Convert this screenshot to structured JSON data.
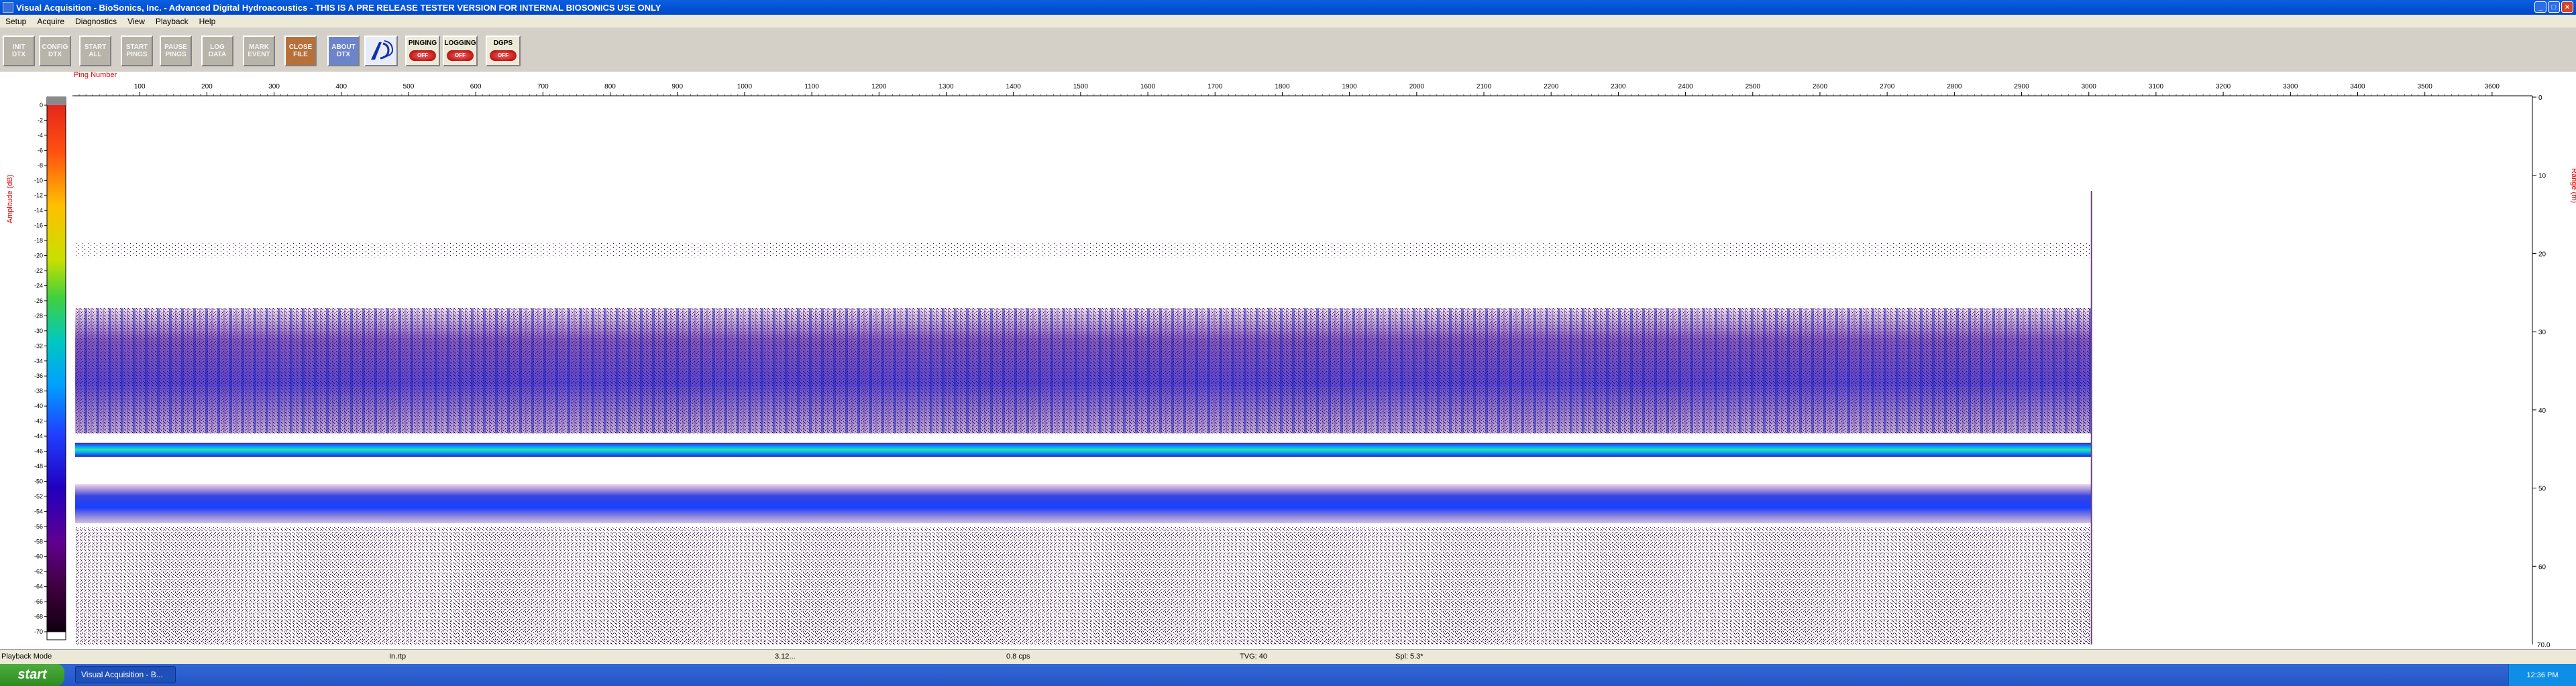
{
  "window": {
    "title": "Visual Acquisition  -  BioSonics, Inc.  -  Advanced Digital Hydroacoustics  -  THIS IS A PRE RELEASE TESTER VERSION FOR INTERNAL BIOSONICS USE ONLY"
  },
  "menu": [
    "Setup",
    "Acquire",
    "Diagnostics",
    "View",
    "Playback",
    "Help"
  ],
  "toolbar": {
    "buttons": [
      {
        "l1": "INIT",
        "l2": "DTX",
        "x": 4
      },
      {
        "l1": "CONFIG",
        "l2": "DTX",
        "x": 58
      },
      {
        "l1": "START",
        "l2": "ALL",
        "x": 118
      },
      {
        "l1": "START",
        "l2": "PINGS",
        "x": 180
      },
      {
        "l1": "PAUSE",
        "l2": "PINGS",
        "x": 238
      },
      {
        "l1": "LOG",
        "l2": "DATA",
        "x": 300
      },
      {
        "l1": "MARK",
        "l2": "EVENT",
        "x": 362
      },
      {
        "l1": "CLOSE",
        "l2": "FILE",
        "x": 424
      },
      {
        "l1": "ABOUT",
        "l2": "DTX",
        "x": 488
      }
    ],
    "indicators": [
      {
        "label": "PINGING",
        "state": "OFF",
        "x": 604
      },
      {
        "label": "LOGGING",
        "state": "OFF",
        "x": 660
      },
      {
        "label": "DGPS",
        "state": "OFF",
        "x": 724
      }
    ]
  },
  "chart_data": {
    "type": "heatmap",
    "xlabel": "Ping Number",
    "ylabel_left": "Amplitude (dB)",
    "ylabel_right": "Range (m)",
    "x_ticks": [
      100,
      200,
      300,
      400,
      500,
      600,
      700,
      800,
      900,
      1000,
      1100,
      1200,
      1300,
      1400,
      1500,
      1600,
      1700,
      1800,
      1900,
      2000,
      2100,
      2200,
      2300,
      2400,
      2500,
      2600,
      2700,
      2800,
      2900,
      3000,
      3100,
      3200,
      3300,
      3400,
      3500,
      3600
    ],
    "xlim": [
      0,
      3660
    ],
    "data_end_ping": 3000,
    "range_ticks": [
      0,
      10,
      20,
      30,
      40,
      50,
      60
    ],
    "range_end_label": "70.0",
    "ylim_range": [
      0,
      70
    ],
    "color_scale_ticks": [
      0,
      -2,
      -4,
      -6,
      -8,
      -10,
      -12,
      -14,
      -16,
      -18,
      -20,
      -22,
      -24,
      -26,
      -28,
      -30,
      -32,
      -34,
      -36,
      -38,
      -40,
      -42,
      -44,
      -46,
      -48,
      -50,
      -52,
      -54,
      -56,
      -58,
      -60,
      -62,
      -64,
      -66,
      -68,
      -70
    ],
    "bands": [
      {
        "range_m": [
          18.5,
          20.5
        ],
        "level": "weak"
      },
      {
        "range_m": [
          27,
          43
        ],
        "level": "moderate"
      },
      {
        "range_m": [
          44.2,
          46.0
        ],
        "level": "strong"
      },
      {
        "range_m": [
          49.5,
          54.5
        ],
        "level": "moderate-strong"
      },
      {
        "range_m": [
          55,
          70
        ],
        "level": "weak-scattered"
      }
    ]
  },
  "status": {
    "mode": "Playback Mode",
    "seg1": "In.rtp",
    "seg2": "3.12...",
    "seg3": "0.8 cps",
    "seg4": "TVG: 40",
    "seg5": "Spl: 5.3*"
  },
  "taskbar": {
    "start": "start",
    "item": "Visual Acquisition - B...",
    "clock": "12:36 PM"
  }
}
